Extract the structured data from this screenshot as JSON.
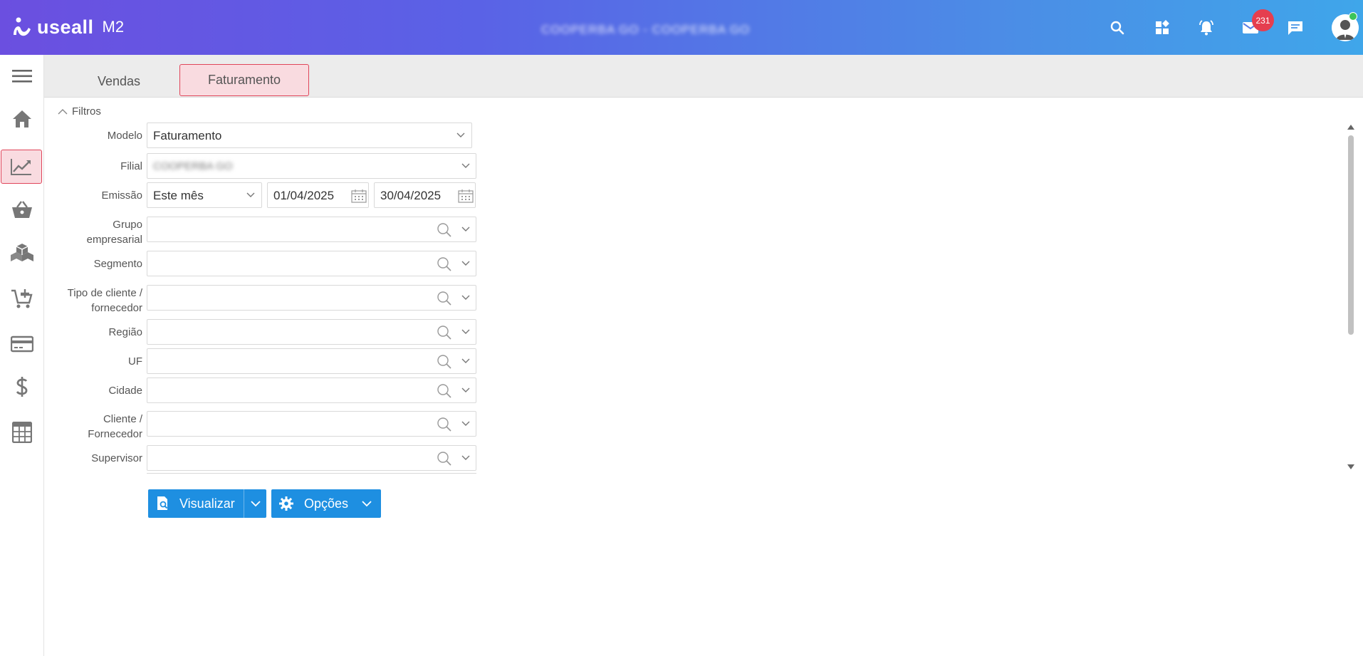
{
  "header": {
    "logo_text": "useall",
    "logo_sub": "M2",
    "company_name": "COOPERBA GO - COOPERBA GO",
    "notification_count": "231",
    "icons": [
      "search-icon",
      "apps-icon",
      "bell-icon",
      "mail-icon",
      "chat-icon",
      "user-avatar"
    ]
  },
  "sidenav": {
    "items": [
      {
        "icon": "menu-icon"
      },
      {
        "icon": "home-icon"
      },
      {
        "icon": "chart-icon",
        "active": true
      },
      {
        "icon": "basket-icon"
      },
      {
        "icon": "boxes-icon"
      },
      {
        "icon": "cart-add-icon"
      },
      {
        "icon": "card-icon"
      },
      {
        "icon": "dollar-icon"
      },
      {
        "icon": "calculator-icon"
      }
    ]
  },
  "tabs": [
    {
      "label": "Vendas",
      "active": false
    },
    {
      "label": "Faturamento",
      "active": true
    }
  ],
  "filters": {
    "toggle_label": "Filtros",
    "modelo": {
      "label": "Modelo",
      "value": "Faturamento"
    },
    "filial": {
      "label": "Filial",
      "value": "COOPERBA GO"
    },
    "emissao": {
      "label": "Emissão",
      "period": "Este mês",
      "start": "01/04/2025",
      "end": "30/04/2025"
    },
    "grupo": {
      "label_1": "Grupo",
      "label_2": "empresarial"
    },
    "segmento": {
      "label": "Segmento"
    },
    "tipo": {
      "label_1": "Tipo de cliente /",
      "label_2": "fornecedor"
    },
    "regiao": {
      "label": "Região"
    },
    "uf": {
      "label": "UF"
    },
    "cidade": {
      "label": "Cidade"
    },
    "cliente": {
      "label_1": "Cliente /",
      "label_2": "Fornecedor"
    },
    "supervisor": {
      "label": "Supervisor"
    }
  },
  "actions": {
    "visualizar": "Visualizar",
    "opcoes": "Opções"
  },
  "colors": {
    "header_start": "#6b4fe0",
    "header_end": "#3fa6ea",
    "accent_blue": "#1e8fe1",
    "active_pink_bg": "#f9dbe0",
    "active_red_border": "#e0455a",
    "badge_red": "#e53e4f"
  }
}
